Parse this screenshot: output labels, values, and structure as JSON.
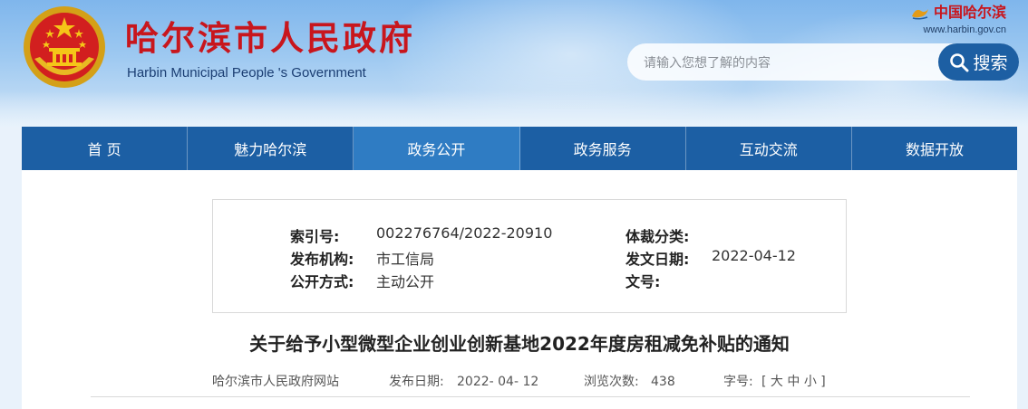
{
  "header": {
    "title": "哈尔滨市人民政府",
    "subtitle": "Harbin Municipal People 's Government",
    "brand_name": "中国哈尔滨",
    "brand_url": "www.harbin.gov.cn",
    "search": {
      "placeholder": "请输入您想了解的内容",
      "button_label": "搜索"
    }
  },
  "nav": {
    "items": [
      {
        "label": "首 页"
      },
      {
        "label": "魅力哈尔滨"
      },
      {
        "label": "政务公开"
      },
      {
        "label": "政务服务"
      },
      {
        "label": "互动交流"
      },
      {
        "label": "数据开放"
      }
    ],
    "active_index": 2
  },
  "meta": {
    "index_no_label": "索引号:",
    "index_no": "002276764/2022-20910",
    "genre_label": "体裁分类:",
    "genre": "",
    "publisher_label": "发布机构:",
    "publisher": "市工信局",
    "date_label": "发文日期:",
    "date": "2022-04-12",
    "disclosure_label": "公开方式:",
    "disclosure": "主动公开",
    "doc_no_label": "文号:",
    "doc_no": ""
  },
  "article": {
    "title": "关于给予小型微型企业创业创新基地2022年度房租减免补贴的通知",
    "source": "哈尔滨市人民政府网站",
    "publish_label": "发布日期:",
    "publish_date": "2022- 04- 12",
    "views_label": "浏览次数:",
    "views": "438",
    "font_size_label": "字号:",
    "font_size_open": "[",
    "font_large": "大",
    "font_medium": "中",
    "font_small": "小",
    "font_size_close": "]"
  },
  "colors": {
    "nav_bg": "#1c5fa4",
    "nav_active": "#2f7cc3",
    "title_red": "#c8161d",
    "search_button": "#1d5fa3"
  }
}
